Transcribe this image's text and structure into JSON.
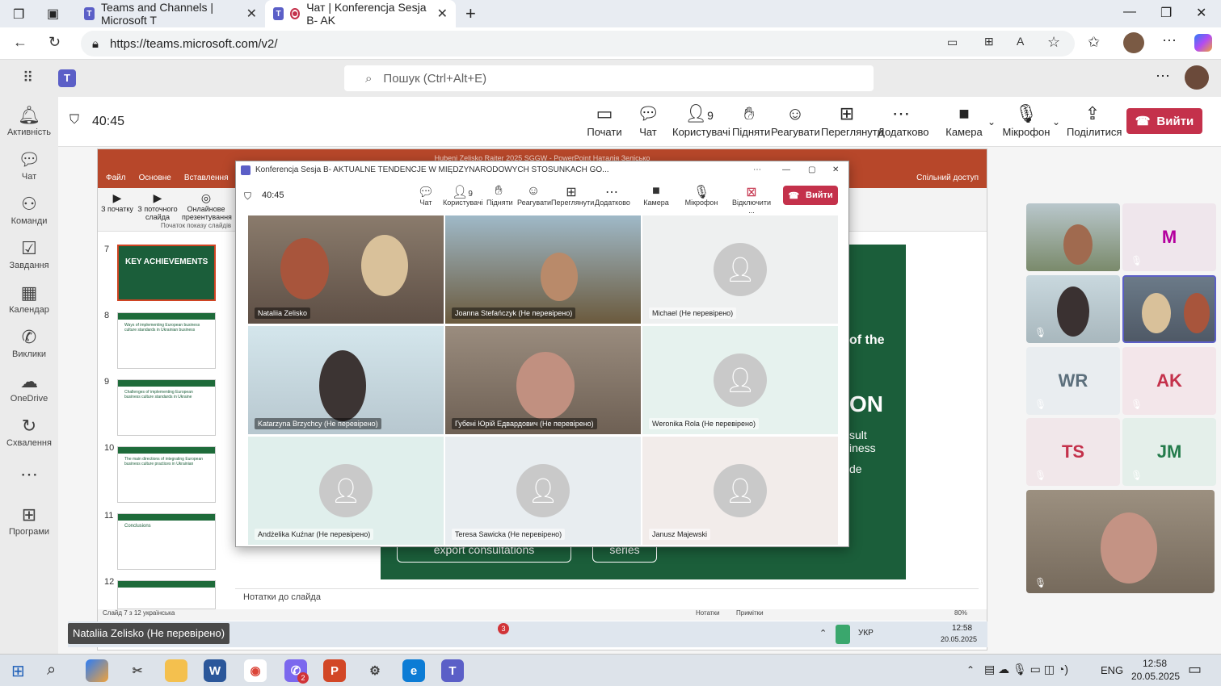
{
  "browser": {
    "tabs": [
      {
        "title": "Teams and Channels | Microsoft T"
      },
      {
        "title": "Чат | Konferencja Sesja B- AK"
      }
    ],
    "url": "https://teams.microsoft.com/v2/"
  },
  "teams": {
    "search_placeholder": "Пошук (Ctrl+Alt+E)",
    "rail": [
      "Активність",
      "Чат",
      "Команди",
      "Завдання",
      "Календар",
      "Виклики",
      "OneDrive",
      "Схвалення",
      "Програми"
    ],
    "timer": "40:45",
    "toolbar": {
      "start": "Почати",
      "chat": "Чат",
      "people": "Користувачі",
      "people_count": "9",
      "raise": "Підняти",
      "react": "Реагувати",
      "view": "Переглянути",
      "more": "Додатково",
      "camera": "Камера",
      "mic": "Мікрофон",
      "share": "Поділитися",
      "leave": "Вийти"
    },
    "right_gallery": {
      "initials": [
        "M",
        "WR",
        "AK",
        "TS",
        "JM"
      ]
    }
  },
  "ppt": {
    "title": "Hubeni Zelisko Raiter 2025 SGGW - PowerPoint",
    "user": "Наталія Зелісько",
    "share_label": "Спільний доступ",
    "tabs": [
      "Файл",
      "Основне",
      "Вставлення",
      "Ко"
    ],
    "tools": [
      {
        "label": "З початку"
      },
      {
        "label": "З поточного слайда"
      },
      {
        "label": "Онлайнове презентування"
      }
    ],
    "group_label": "Початок показу слайдів",
    "slide_numbers": [
      "7",
      "8",
      "9",
      "10",
      "11",
      "12"
    ],
    "thumb_titles": [
      "KEY ACHIEVEMENTS",
      "Ways of implementing European business culture standards in Ukrainian business",
      "Challenges of implementing European business culture standards in Ukraine",
      "The main directions of integrating European business culture practices in Ukrainian",
      "Conclusions",
      ""
    ],
    "slide_text_1": "of the",
    "slide_text_2": "ON",
    "slide_text_3": "sult",
    "slide_text_4": "iness",
    "slide_text_5": "de",
    "slide_text_6": "export consultations",
    "slide_text_7": "series",
    "notes": "Нотатки до слайда",
    "status_left": "Слайд 7 з 12",
    "status_lang": "українська",
    "status_notes": "Нотатки",
    "status_comments": "Примітки",
    "zoom": "80%"
  },
  "popup": {
    "title": "Konferencja Sesja B- AKTUALNE TENDENCJE W MIĘDZYNARODOWYCH STOSUNKACH GO...",
    "timer": "40:45",
    "toolbar": {
      "chat": "Чат",
      "people": "Користувачі",
      "people_count": "9",
      "raise": "Підняти",
      "react": "Реагувати",
      "view": "Переглянути",
      "more": "Додатково",
      "camera": "Камера",
      "mic": "Мікрофон",
      "disconnect": "Відключити ...",
      "leave": "Вийти"
    },
    "tiles": [
      {
        "name": "Nataliia Zelisko"
      },
      {
        "name": "Joanna Stefańczyk (Не перевірено)"
      },
      {
        "name": "Michael (Не перевірено)"
      },
      {
        "name": "Katarzyna Brzychcy (Не перевірено)"
      },
      {
        "name": "Губені Юрій Едвардович (Не перевірено)"
      },
      {
        "name": "Weronika Rola (Не перевірено)"
      },
      {
        "name": "Andżelika Kuźnar (Не перевірено)"
      },
      {
        "name": "Teresa Sawicka (Не перевірено)"
      },
      {
        "name": "Janusz Majewski"
      }
    ]
  },
  "inner_task": {
    "caption": "Nataliia Zelisko (Не перевірено)",
    "lang": "УКР",
    "time": "12:58",
    "date": "20.05.2025",
    "badge": "3"
  },
  "taskbar": {
    "lang": "ENG",
    "time": "12:58",
    "date": "20.05.2025",
    "badge": "2"
  }
}
